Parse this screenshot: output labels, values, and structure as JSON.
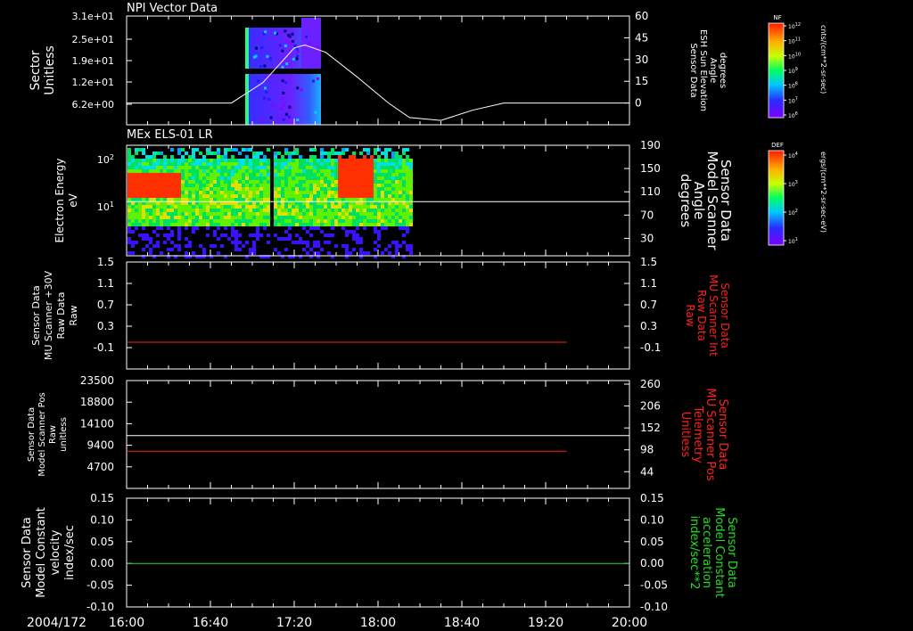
{
  "date_label": "2004/172",
  "x_ticks": [
    "16:00",
    "16:40",
    "17:20",
    "18:00",
    "18:40",
    "19:20",
    "20:00"
  ],
  "colors": {
    "white": "#ffffff",
    "red": "#ff2020",
    "green": "#22dd22",
    "frame": "#ffffff"
  },
  "chart_data": [
    {
      "type": "heatmap",
      "title": "NPI Vector Data",
      "ylabel_lines": [
        "Sector",
        "Unitless"
      ],
      "yticks_left": [
        "3.1e+01",
        "2.5e+01",
        "1.9e+01",
        "1.2e+01",
        "6.2e+00"
      ],
      "ylabel_right_lines": [
        "Sensor Data",
        "ESH Sun Elevation",
        "Angle",
        "degrees"
      ],
      "yticks_right": [
        "60",
        "45",
        "30",
        "15",
        "0"
      ],
      "ylim_right": [
        -15,
        60
      ],
      "data_time_range": [
        "16:50",
        "17:25"
      ],
      "line_series": {
        "color": "white",
        "x": [
          "16:00",
          "16:50",
          "17:05",
          "17:15",
          "17:20",
          "17:25",
          "17:35",
          "17:50",
          "18:05",
          "18:15",
          "18:30",
          "18:45",
          "19:00",
          "20:00"
        ],
        "values": [
          0,
          0,
          14,
          30,
          38,
          40,
          35,
          18,
          0,
          -10,
          -12,
          -5,
          0,
          0
        ]
      },
      "colorbar": {
        "label": "NF",
        "units": "cnts/(cm**2-sr-sec)",
        "ticks": [
          "10^12",
          "10^11",
          "10^10",
          "10^9",
          "10^8",
          "10^7",
          "10^6"
        ]
      }
    },
    {
      "type": "heatmap",
      "title": "MEx ELS-01 LR",
      "ylabel_lines": [
        "Electron Energy",
        "eV"
      ],
      "yticks_left": [
        "10^2",
        "10^1"
      ],
      "ylabel_right_lines": [
        "Sensor Data",
        "Model Scanner",
        "Angle",
        "degrees"
      ],
      "yticks_right": [
        "190",
        "150",
        "110",
        "70",
        "30"
      ],
      "ylim_right": [
        0,
        190
      ],
      "data_time_range": [
        "16:00",
        "18:15"
      ],
      "line_series": {
        "color": "white",
        "x": [
          "16:00",
          "20:00"
        ],
        "values": [
          93,
          93
        ]
      },
      "colorbar": {
        "label": "DEF",
        "units": "ergs/(cm**2-sr-sec-eV)",
        "ticks": [
          "10^4",
          "10^3",
          "10^2",
          "10^1"
        ]
      }
    },
    {
      "type": "line",
      "ylabel_lines": [
        "Sensor Data",
        "MU Scanner +30V",
        "Raw Data",
        "Raw"
      ],
      "yticks_left": [
        "1.5",
        "1.1",
        "0.7",
        "0.3",
        "-0.1"
      ],
      "ylabel_right_lines": [
        "Sensor Data",
        "MU Scanner Int",
        "Raw Data",
        "Raw"
      ],
      "yticks_right": [
        "1.5",
        "1.1",
        "0.7",
        "0.3",
        "-0.1"
      ],
      "ylim": [
        -0.5,
        1.5
      ],
      "series": [
        {
          "color": "red",
          "x": [
            "16:00",
            "19:30"
          ],
          "values": [
            0.0,
            0.0
          ]
        }
      ]
    },
    {
      "type": "line",
      "ylabel_lines": [
        "Sensor Data",
        "Model Scanner Pos",
        "Raw",
        "unitless"
      ],
      "yticks_left": [
        "23500",
        "18800",
        "14100",
        "9400",
        "4700"
      ],
      "ylabel_right_lines": [
        "Sensor Data",
        "MU Scanner Pos",
        "Telemetry",
        "Unitless"
      ],
      "yticks_right": [
        "260",
        "206",
        "152",
        "98",
        "44"
      ],
      "ylim": [
        0,
        23500
      ],
      "series": [
        {
          "color": "white",
          "x": [
            "16:00",
            "20:00"
          ],
          "values": [
            11500,
            11500
          ]
        },
        {
          "color": "red",
          "x": [
            "16:00",
            "19:30"
          ],
          "values": [
            8100,
            8100
          ]
        }
      ]
    },
    {
      "type": "line",
      "ylabel_lines": [
        "Sensor Data",
        "Model Constant",
        "velocity",
        "index/sec"
      ],
      "yticks_left": [
        "0.15",
        "0.10",
        "0.05",
        "0.00",
        "-0.05",
        "-0.10"
      ],
      "ylabel_right_lines": [
        "Sensor Data",
        "Model Constant",
        "acceleration",
        "index/sec**2"
      ],
      "yticks_right": [
        "0.15",
        "0.10",
        "0.05",
        "0.00",
        "-0.05",
        "-0.10"
      ],
      "ylim": [
        -0.1,
        0.15
      ],
      "series": [
        {
          "color": "green",
          "x": [
            "16:00",
            "20:00"
          ],
          "values": [
            0.0,
            0.0
          ]
        }
      ]
    }
  ]
}
